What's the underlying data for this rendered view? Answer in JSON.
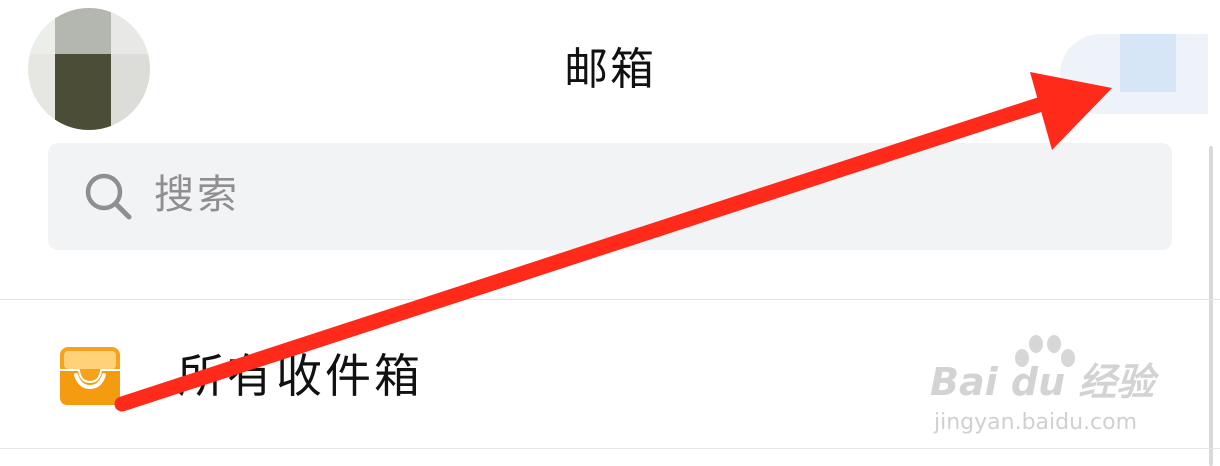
{
  "header": {
    "title": "邮箱",
    "add_icon": "plus-icon",
    "avatar_icon": "user-avatar"
  },
  "search": {
    "placeholder": "搜索",
    "icon": "search-icon"
  },
  "mailboxes": [
    {
      "label": "所有收件箱",
      "icon": "inbox-tray-icon"
    }
  ],
  "watermark": {
    "main": "Bai du 经验",
    "sub": "jingyan.baidu.com"
  },
  "colors": {
    "annotation_arrow": "#ff2a1a",
    "inbox_icon": "#f7a21b",
    "search_bg": "#f2f3f5"
  }
}
